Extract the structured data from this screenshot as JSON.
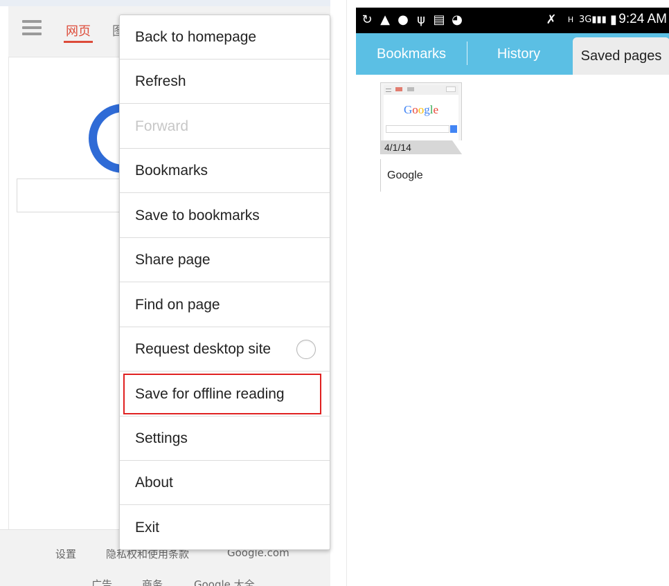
{
  "left": {
    "tab_web": "网页",
    "tab_image": "图",
    "footer_row1": [
      "设置",
      "隐私权和使用条款",
      "Google.com"
    ],
    "footer_row2": [
      "广告",
      "商务",
      "Google 大全"
    ]
  },
  "menu": {
    "items": [
      {
        "label": "Back to homepage",
        "enabled": true
      },
      {
        "label": "Refresh",
        "enabled": true
      },
      {
        "label": "Forward",
        "enabled": false
      },
      {
        "label": "Bookmarks",
        "enabled": true
      },
      {
        "label": "Save to bookmarks",
        "enabled": true
      },
      {
        "label": "Share page",
        "enabled": true
      },
      {
        "label": "Find on page",
        "enabled": true
      },
      {
        "label": "Request desktop site",
        "enabled": true,
        "toggle": false
      },
      {
        "label": "Save for offline reading",
        "enabled": true,
        "highlighted": true
      },
      {
        "label": "Settings",
        "enabled": true
      },
      {
        "label": "About",
        "enabled": true
      },
      {
        "label": "Exit",
        "enabled": true
      }
    ]
  },
  "right": {
    "status_time": "9:24 AM",
    "network": "3G",
    "tabs": [
      "Bookmarks",
      "History",
      "Saved pages"
    ],
    "selected_tab": "Saved pages",
    "saved_page": {
      "thumb_logo": "Google",
      "date": "4/1/14",
      "title": "Google"
    }
  },
  "colors": {
    "accent_red": "#dd4b39",
    "tabbar_blue": "#5bbfe4",
    "highlight_border": "#e02020",
    "google_blue": "#2f6bd6"
  }
}
